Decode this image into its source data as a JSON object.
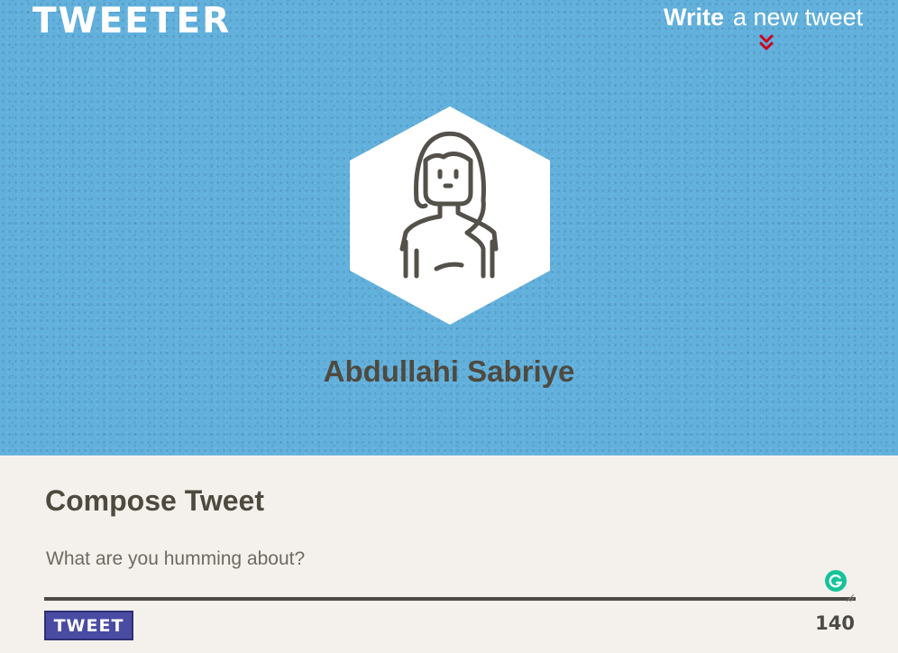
{
  "header": {
    "brand": "TWEETER",
    "compose_toggle": {
      "strong": "Write",
      "rest": "a new tweet",
      "icon": "double-chevron-down-icon"
    }
  },
  "profile": {
    "avatar_icon": "woman-avatar-icon",
    "name": "Abdullahi Sabriye"
  },
  "composer": {
    "title": "Compose Tweet",
    "placeholder": "What are you humming about?",
    "value": "",
    "button_label": "TWEET",
    "counter": "140",
    "grammarly_icon": "grammarly-icon"
  },
  "colors": {
    "header_bg": "#62b0dc",
    "page_bg": "#f4f1ec",
    "text_dark": "#4e4a3f",
    "button_bg": "#4a4ba2",
    "chevron": "#d0021b",
    "grammarly": "#15c39a"
  }
}
